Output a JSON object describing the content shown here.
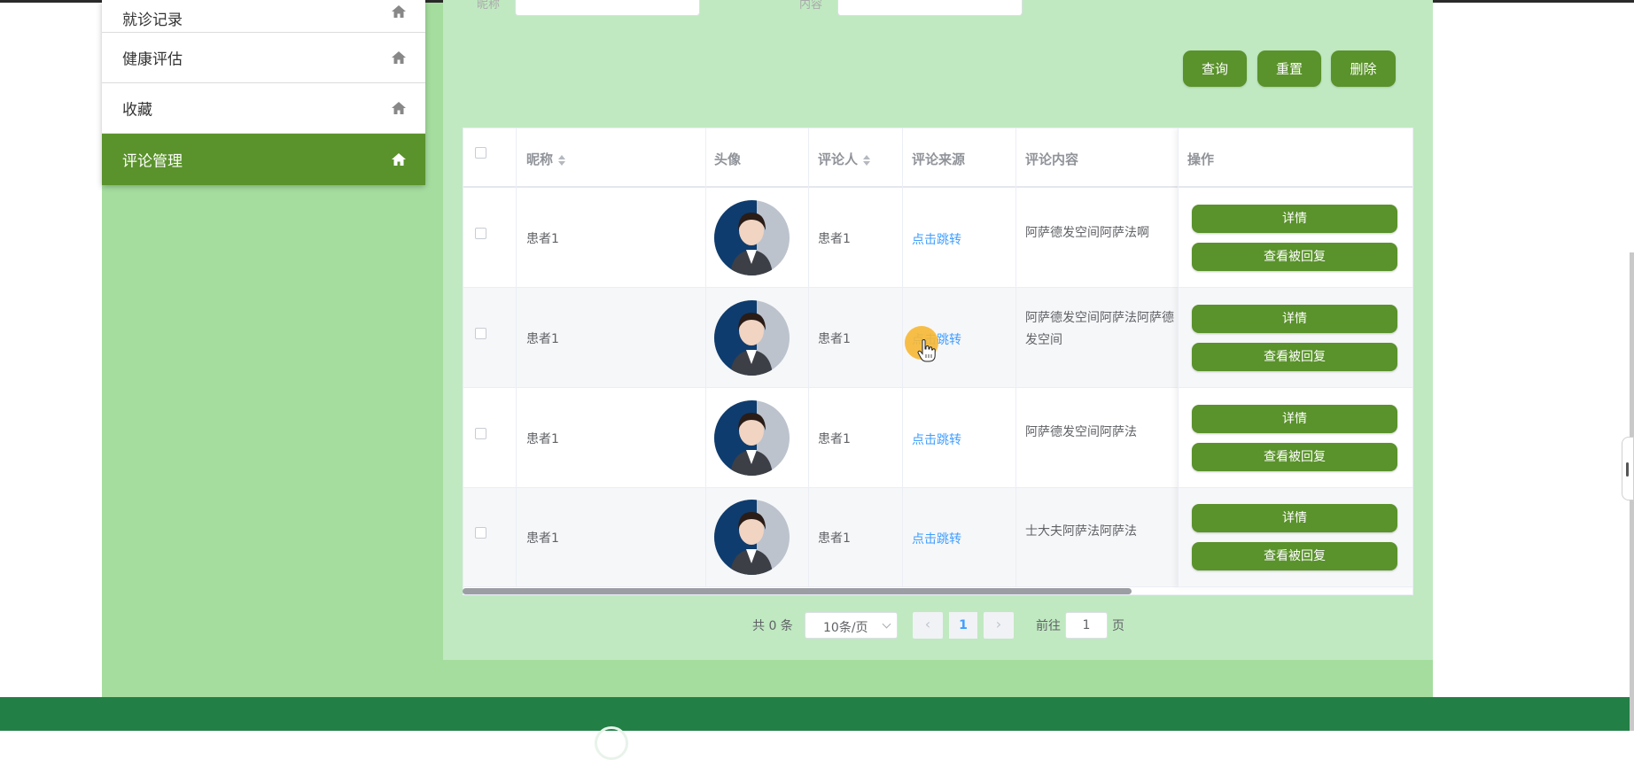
{
  "sidebar": {
    "items": [
      {
        "label": "就诊记录",
        "icon": "home-icon"
      },
      {
        "label": "健康评估",
        "icon": "home-icon"
      },
      {
        "label": "收藏",
        "icon": "home-icon"
      },
      {
        "label": "评论管理",
        "icon": "home-icon",
        "active": true
      }
    ]
  },
  "search": {
    "field1_label": "昵称",
    "field2_label": "内容",
    "query_button": "查询",
    "reset_button": "重置",
    "delete_button": "删除"
  },
  "table": {
    "headers": {
      "nickname": "昵称",
      "avatar": "头像",
      "commenter": "评论人",
      "source": "评论来源",
      "content": "评论内容",
      "actions": "操作"
    },
    "rows": [
      {
        "nickname": "患者1",
        "commenter": "患者1",
        "source": "点击跳转",
        "content": "阿萨德发空间阿萨法啊"
      },
      {
        "nickname": "患者1",
        "commenter": "患者1",
        "source": "点击跳转",
        "content": "阿萨德发空间阿萨法阿萨德发空间"
      },
      {
        "nickname": "患者1",
        "commenter": "患者1",
        "source": "点击跳转",
        "content": "阿萨德发空间阿萨法"
      },
      {
        "nickname": "患者1",
        "commenter": "患者1",
        "source": "点击跳转",
        "content": "士大夫阿萨法阿萨法"
      }
    ],
    "detail_button": "详情",
    "view_reply_button": "查看被回复"
  },
  "pagination": {
    "total": "共 0 条",
    "page_size": "10条/页",
    "current_page": "1",
    "goto_label": "前往",
    "goto_value": "1",
    "page_suffix": "页"
  },
  "colors": {
    "accent": "#5a922b",
    "content_bg": "#a5dd9f",
    "panel_bg": "#c0e9c1",
    "footer": "#227f46",
    "link": "#409eff"
  }
}
